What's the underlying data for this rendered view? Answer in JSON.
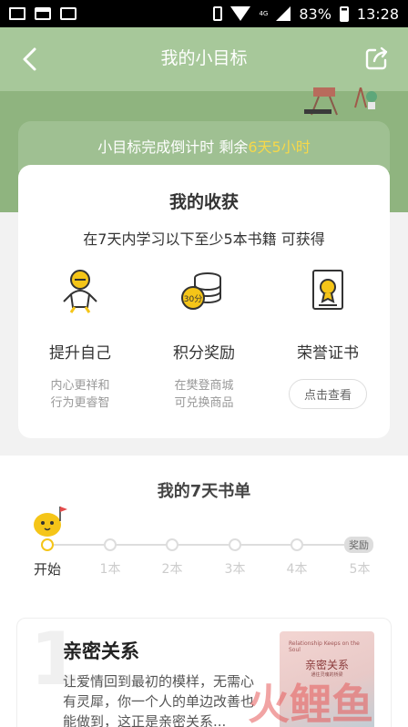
{
  "status_bar": {
    "battery": "83%",
    "time": "13:28",
    "network": "4G"
  },
  "header": {
    "title": "我的小目标"
  },
  "countdown": {
    "prefix": "小目标完成倒计时 剩余",
    "remaining": "6天5小时"
  },
  "harvest": {
    "title": "我的收获",
    "subtitle": "在7天内学习以下至少5本书籍 可获得",
    "rewards": [
      {
        "icon": "astronaut-icon",
        "title": "提升自己",
        "desc1": "内心更祥和",
        "desc2": "行为更睿智"
      },
      {
        "icon": "coins-30-icon",
        "icon_text": "30分",
        "title": "积分奖励",
        "desc1": "在樊登商城",
        "desc2": "可兑换商品"
      },
      {
        "icon": "certificate-icon",
        "title": "荣誉证书",
        "button": "点击查看"
      }
    ]
  },
  "book_list": {
    "title": "我的7天书单",
    "steps": [
      "开始",
      "1本",
      "2本",
      "3本",
      "4本",
      "5本"
    ],
    "reward_badge": "奖励",
    "current_step": 0
  },
  "books": [
    {
      "number": "1",
      "title": "亲密关系",
      "desc": "让爱情回到最初的模样，无需心有灵犀，你一个人的单边改善也能做到，这正是亲密关系...",
      "cover": {
        "title": "亲密关系",
        "subtitle_en": "Relationship Keeps on the Soul",
        "caption": "通往灵魂的桥梁"
      }
    }
  ],
  "watermark": "火鲤鱼",
  "colors": {
    "header_green": "#a7c89a",
    "highlight_yellow": "#f6d84a",
    "progress_active": "#f5c518"
  }
}
